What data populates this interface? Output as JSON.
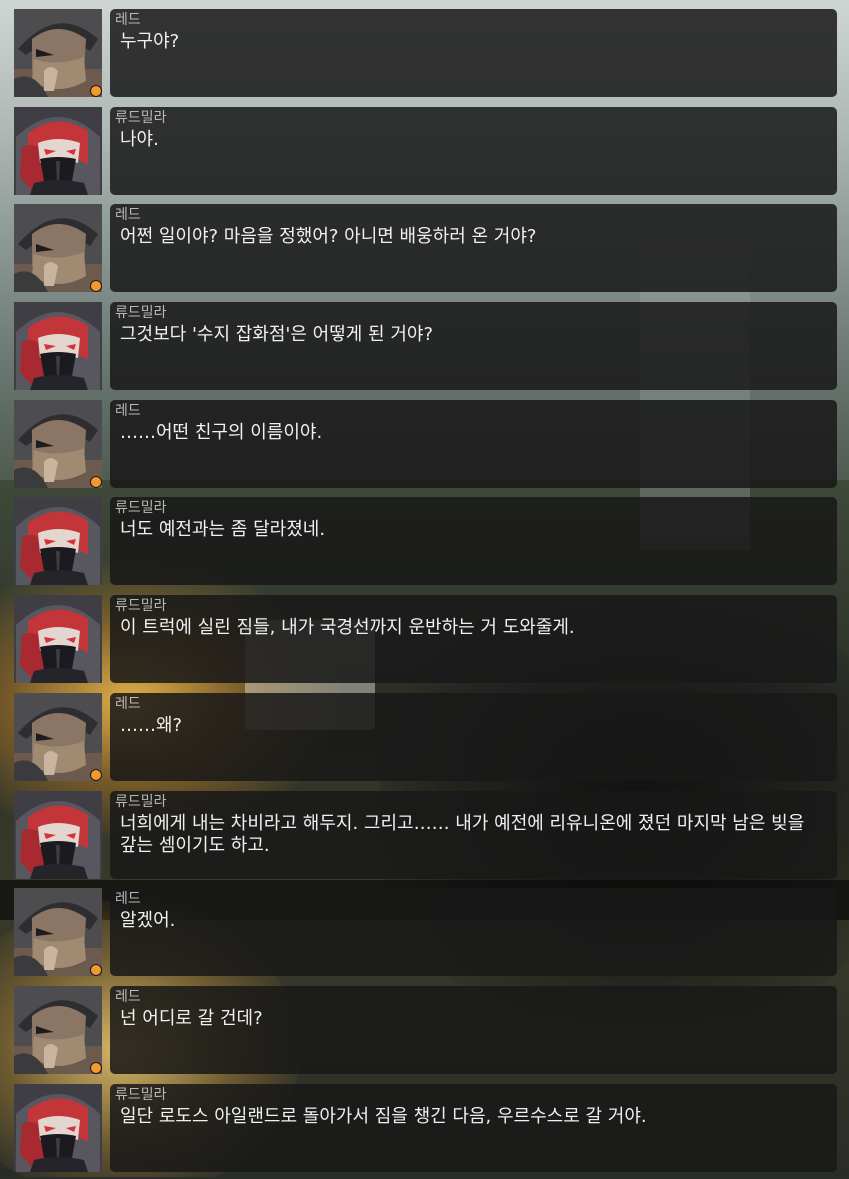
{
  "speakers": {
    "red": "레드",
    "ludmila": "류드밀라"
  },
  "messages": [
    {
      "speaker": "레드",
      "avatar": "red",
      "text": "누구야?"
    },
    {
      "speaker": "류드밀라",
      "avatar": "ludmila",
      "text": "나야."
    },
    {
      "speaker": "레드",
      "avatar": "red",
      "text": "어쩐 일이야? 마음을 정했어? 아니면 배웅하러 온 거야?"
    },
    {
      "speaker": "류드밀라",
      "avatar": "ludmila",
      "text": "그것보다 '수지 잡화점'은 어떻게 된 거야?"
    },
    {
      "speaker": "레드",
      "avatar": "red",
      "text": "……어떤 친구의 이름이야."
    },
    {
      "speaker": "류드밀라",
      "avatar": "ludmila",
      "text": "너도 예전과는 좀 달라졌네."
    },
    {
      "speaker": "류드밀라",
      "avatar": "ludmila",
      "text": "이 트럭에 실린 짐들, 내가 국경선까지 운반하는 거 도와줄게."
    },
    {
      "speaker": "레드",
      "avatar": "red",
      "text": "……왜?"
    },
    {
      "speaker": "류드밀라",
      "avatar": "ludmila",
      "text": "너희에게 내는 차비라고 해두지. 그리고…… 내가 예전에 리유니온에 졌던 마지막 남은 빚을 갚는 셈이기도 하고."
    },
    {
      "speaker": "레드",
      "avatar": "red",
      "text": "알겠어."
    },
    {
      "speaker": "레드",
      "avatar": "red",
      "text": "넌 어디로 갈 건데?"
    },
    {
      "speaker": "류드밀라",
      "avatar": "ludmila",
      "text": "일단 로도스 아일랜드로 돌아가서 짐을 챙긴 다음, 우르수스로 갈 거야."
    }
  ]
}
